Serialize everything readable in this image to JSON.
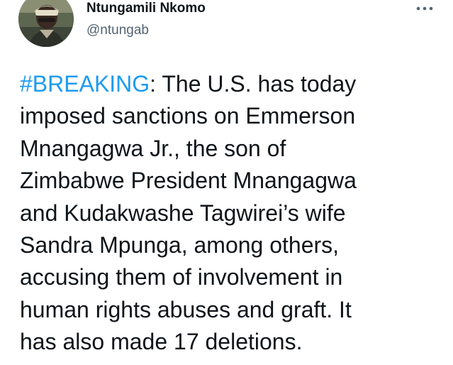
{
  "author": {
    "display_name": "Ntungamili Nkomo",
    "handle": "@ntungab"
  },
  "tweet": {
    "hashtag": "#BREAKING",
    "first_line_rest": ": The U.S. has today",
    "lines": [
      "imposed sanctions on Emmerson",
      "Mnangagwa Jr., the son of",
      "Zimbabwe President Mnangagwa",
      "and Kudakwashe Tagwirei’s wife",
      "Sandra Mpunga, among others,",
      "accusing them of involvement in",
      "human rights abuses and graft. It",
      "has also made 17 deletions."
    ]
  },
  "colors": {
    "hashtag": "#1d9bf0",
    "text": "#0f1419",
    "secondary": "#536471"
  },
  "icons": {
    "more": "more-horizontal-icon"
  }
}
